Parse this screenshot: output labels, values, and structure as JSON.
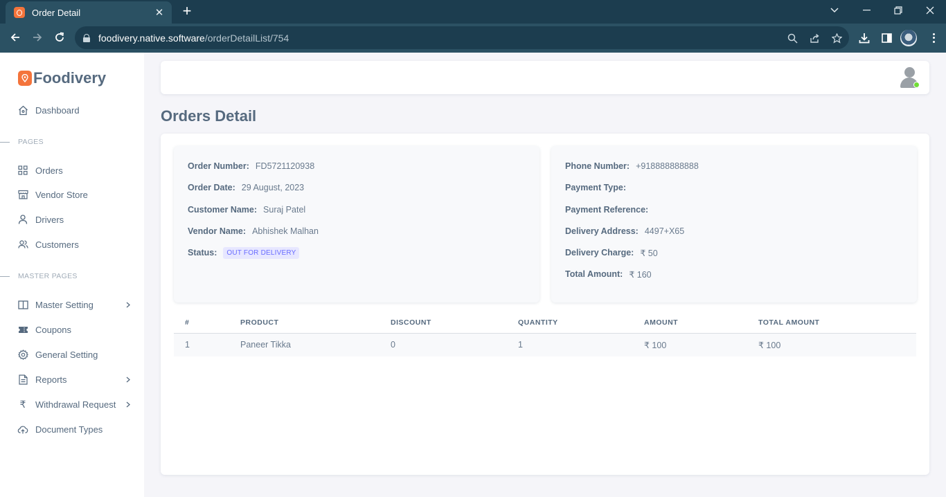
{
  "browser": {
    "tab_title": "Order Detail",
    "url_host": "foodivery.native.software",
    "url_path": "/orderDetailList/754"
  },
  "sidebar": {
    "brand": "Foodivery",
    "dashboard": "Dashboard",
    "sections": [
      "PAGES",
      "MASTER PAGES"
    ],
    "pages": [
      "Orders",
      "Vendor Store",
      "Drivers",
      "Customers"
    ],
    "master": [
      {
        "label": "Master Setting",
        "icon": "book-icon"
      },
      {
        "label": "Coupons",
        "icon": "ticket-icon"
      },
      {
        "label": "General Setting",
        "icon": "gear-icon"
      },
      {
        "label": "Reports",
        "icon": "file-icon"
      },
      {
        "label": "Withdrawal Request",
        "icon": "rupee-icon"
      },
      {
        "label": "Document Types",
        "icon": "cloud-upload-icon"
      }
    ]
  },
  "page": {
    "title": "Orders Detail"
  },
  "order": {
    "left": [
      {
        "key": "Order Number:",
        "value": "FD5721120938"
      },
      {
        "key": "Order Date:",
        "value": "29 August, 2023"
      },
      {
        "key": "Customer Name:",
        "value": "Suraj Patel"
      },
      {
        "key": "Vendor Name:",
        "value": "Abhishek Malhan"
      },
      {
        "key": "Status:",
        "value": "OUT FOR DELIVERY"
      }
    ],
    "right": [
      {
        "key": "Phone Number:",
        "value": "+918888888888"
      },
      {
        "key": "Payment Type:",
        "value": ""
      },
      {
        "key": "Payment Reference:",
        "value": ""
      },
      {
        "key": "Delivery Address:",
        "value": "4497+X65"
      },
      {
        "key": "Delivery Charge:",
        "value": "₹ 50"
      },
      {
        "key": "Total Amount:",
        "value": "₹ 160"
      }
    ]
  },
  "table": {
    "headers": [
      "#",
      "PRODUCT",
      "DISCOUNT",
      "QUANTITY",
      "AMOUNT",
      "TOTAL AMOUNT"
    ],
    "rows": [
      [
        "1",
        "Paneer Tikka",
        "0",
        "1",
        "₹ 100",
        "₹ 100"
      ]
    ]
  },
  "colors": {
    "accent": "#696cff",
    "brand": "#f4743b",
    "online": "#71dd37"
  }
}
